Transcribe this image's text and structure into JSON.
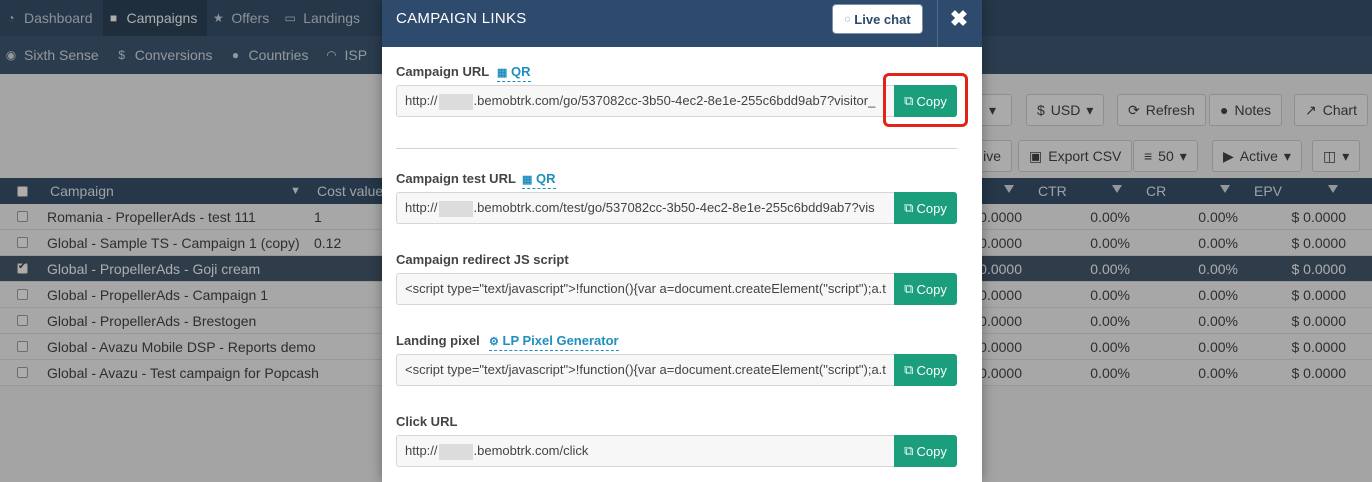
{
  "app": {
    "topnav": [
      {
        "icon": "dashboard-icon",
        "glyph": "◔",
        "label": "Dashboard"
      },
      {
        "icon": "briefcase-icon",
        "glyph": "■",
        "label": "Campaigns"
      },
      {
        "icon": "star-icon",
        "glyph": "★",
        "label": "Offers"
      },
      {
        "icon": "window-icon",
        "glyph": "▭",
        "label": "Landings"
      }
    ],
    "subnav": [
      {
        "icon": "eye-icon",
        "glyph": "◉",
        "label": "Sixth Sense"
      },
      {
        "icon": "dollar-icon",
        "glyph": "$",
        "label": "Conversions"
      },
      {
        "icon": "globe-icon",
        "glyph": "●",
        "label": "Countries"
      },
      {
        "icon": "wifi-icon",
        "glyph": "◠",
        "label": "ISP"
      }
    ],
    "toolbar": {
      "currency": "USD",
      "refresh": "Refresh",
      "notes": "Notes",
      "chart": "Chart",
      "archive": "ive",
      "export": "Export CSV",
      "per_page": "50",
      "status": "Active"
    },
    "table": {
      "columns": {
        "campaign": "Campaign",
        "cost": "Cost value",
        "ctr": "CTR",
        "cr": "CR",
        "epv": "EPV"
      },
      "rows": [
        {
          "name": "Romania - PropellerAds - test 111",
          "cost": "1",
          "epc": "0.0000",
          "ctr": "0.00%",
          "cr": "0.00%",
          "epv": "$ 0.0000"
        },
        {
          "name": "Global - Sample TS - Campaign 1 (copy)",
          "cost": "0.12",
          "epc": "0.0000",
          "ctr": "0.00%",
          "cr": "0.00%",
          "epv": "$ 0.0000"
        },
        {
          "name": "Global - PropellerAds - Goji cream",
          "cost": "",
          "epc": "0.0000",
          "ctr": "0.00%",
          "cr": "0.00%",
          "epv": "$ 0.0000"
        },
        {
          "name": "Global - PropellerAds - Campaign 1",
          "cost": "",
          "epc": "0.0000",
          "ctr": "0.00%",
          "cr": "0.00%",
          "epv": "$ 0.0000"
        },
        {
          "name": "Global - PropellerAds - Brestogen",
          "cost": "",
          "epc": "0.0000",
          "ctr": "0.00%",
          "cr": "0.00%",
          "epv": "$ 0.0000"
        },
        {
          "name": "Global - Avazu Mobile DSP - Reports demo",
          "cost": "",
          "epc": "0.0000",
          "ctr": "0.00%",
          "cr": "0.00%",
          "epv": "$ 0.0000"
        },
        {
          "name": "Global - Avazu - Test campaign for Popcash",
          "cost": "",
          "epc": "0.0000",
          "ctr": "0.00%",
          "cr": "0.00%",
          "epv": "$ 0.0000"
        }
      ]
    }
  },
  "modal": {
    "title": "CAMPAIGN LINKS",
    "live_chat": "Live chat",
    "close": "✖",
    "copy_label": "Copy",
    "fields": {
      "campaign_url": {
        "label": "Campaign URL",
        "link": "QR",
        "prefix": "http://",
        "value": ".bemobtrk.com/go/537082cc-3b50-4ec2-8e1e-255c6bdd9ab7?visitor_"
      },
      "campaign_test_url": {
        "label": "Campaign test URL",
        "link": "QR",
        "prefix": "http://",
        "value": ".bemobtrk.com/test/go/537082cc-3b50-4ec2-8e1e-255c6bdd9ab7?vis"
      },
      "redirect_js": {
        "label": "Campaign redirect JS script",
        "value": "<script type=\"text/javascript\">!function(){var a=document.createElement(\"script\");a.t"
      },
      "landing_pixel": {
        "label": "Landing pixel",
        "link": "LP Pixel Generator",
        "value": "<script type=\"text/javascript\">!function(){var a=document.createElement(\"script\");a.t"
      },
      "click_url": {
        "label": "Click URL",
        "prefix": "http://",
        "value": ".bemobtrk.com/click"
      }
    }
  },
  "colors": {
    "nav": "#24415d",
    "accent": "#1a9e7c",
    "link": "#1e8fbf",
    "highlight": "#e2231a",
    "modal_header": "#2e4a6c"
  }
}
